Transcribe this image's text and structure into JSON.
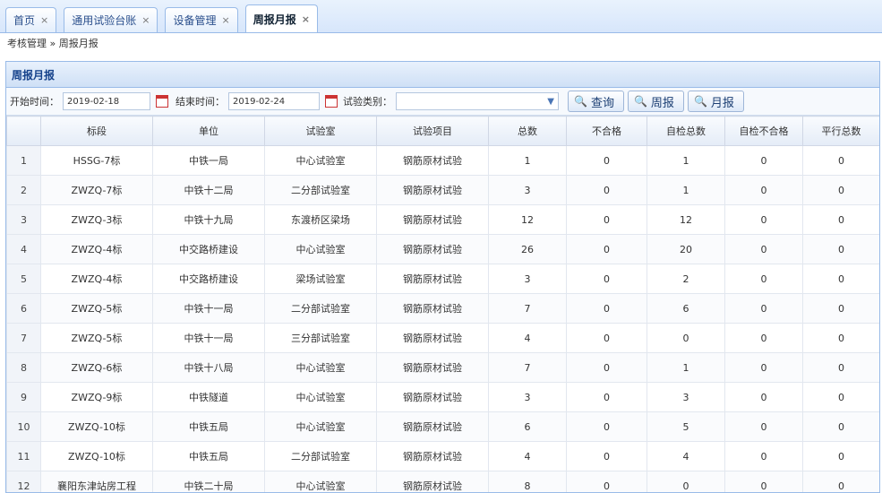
{
  "tabs": [
    {
      "label": "首页",
      "active": false
    },
    {
      "label": "通用试验台账",
      "active": false
    },
    {
      "label": "设备管理",
      "active": false
    },
    {
      "label": "周报月报",
      "active": true
    }
  ],
  "breadcrumb": "考核管理 » 周报月报",
  "panel_title": "周报月报",
  "filters": {
    "start_label": "开始时间：",
    "start_value": "2019-02-18",
    "end_label": "结束时间：",
    "end_value": "2019-02-24",
    "type_label": "试验类别：",
    "type_value": ""
  },
  "buttons": {
    "query": "查询",
    "weekly": "周报",
    "monthly": "月报"
  },
  "columns": [
    "",
    "标段",
    "单位",
    "试验室",
    "试验项目",
    "总数",
    "不合格",
    "自检总数",
    "自检不合格",
    "平行总数"
  ],
  "rows": [
    [
      "1",
      "HSSG-7标",
      "中铁一局",
      "中心试验室",
      "钢筋原材试验",
      "1",
      "0",
      "1",
      "0",
      "0"
    ],
    [
      "2",
      "ZWZQ-7标",
      "中铁十二局",
      "二分部试验室",
      "钢筋原材试验",
      "3",
      "0",
      "1",
      "0",
      "0"
    ],
    [
      "3",
      "ZWZQ-3标",
      "中铁十九局",
      "东渡桥区梁场",
      "钢筋原材试验",
      "12",
      "0",
      "12",
      "0",
      "0"
    ],
    [
      "4",
      "ZWZQ-4标",
      "中交路桥建设",
      "中心试验室",
      "钢筋原材试验",
      "26",
      "0",
      "20",
      "0",
      "0"
    ],
    [
      "5",
      "ZWZQ-4标",
      "中交路桥建设",
      "梁场试验室",
      "钢筋原材试验",
      "3",
      "0",
      "2",
      "0",
      "0"
    ],
    [
      "6",
      "ZWZQ-5标",
      "中铁十一局",
      "二分部试验室",
      "钢筋原材试验",
      "7",
      "0",
      "6",
      "0",
      "0"
    ],
    [
      "7",
      "ZWZQ-5标",
      "中铁十一局",
      "三分部试验室",
      "钢筋原材试验",
      "4",
      "0",
      "0",
      "0",
      "0"
    ],
    [
      "8",
      "ZWZQ-6标",
      "中铁十八局",
      "中心试验室",
      "钢筋原材试验",
      "7",
      "0",
      "1",
      "0",
      "0"
    ],
    [
      "9",
      "ZWZQ-9标",
      "中铁隧道",
      "中心试验室",
      "钢筋原材试验",
      "3",
      "0",
      "3",
      "0",
      "0"
    ],
    [
      "10",
      "ZWZQ-10标",
      "中铁五局",
      "中心试验室",
      "钢筋原材试验",
      "6",
      "0",
      "5",
      "0",
      "0"
    ],
    [
      "11",
      "ZWZQ-10标",
      "中铁五局",
      "二分部试验室",
      "钢筋原材试验",
      "4",
      "0",
      "4",
      "0",
      "0"
    ],
    [
      "12",
      "襄阳东津站房工程",
      "中铁二十局",
      "中心试验室",
      "钢筋原材试验",
      "8",
      "0",
      "0",
      "0",
      "0"
    ]
  ],
  "colors": {
    "header_blue": "#15428b",
    "border": "#99bbe8"
  },
  "icons": {
    "tab_close": "×",
    "search": "🔍",
    "calendar": "calendar-icon",
    "dropdown": "chevron-down-icon"
  }
}
